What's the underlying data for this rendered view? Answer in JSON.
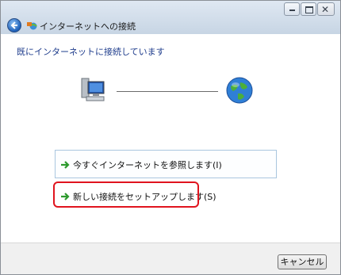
{
  "window": {
    "title": "インターネットへの接続",
    "controls": [
      "minimize",
      "maximize",
      "close"
    ]
  },
  "header": {
    "back_icon": "back-arrow-icon",
    "app_icon": "network-connect-icon"
  },
  "main": {
    "status_text": "既にインターネットに接続しています",
    "diagram": {
      "left_icon": "computer-icon",
      "right_icon": "globe-icon"
    },
    "options": [
      {
        "label": "今すぐインターネットを参照します(I)",
        "icon": "green-arrow-icon"
      },
      {
        "label": "新しい接続をセットアップします(S)",
        "icon": "green-arrow-icon",
        "annotated": true
      }
    ]
  },
  "footer": {
    "cancel_label": "キャンセル"
  },
  "colors": {
    "heading": "#1e3c8c",
    "annotation_border": "#e0141e",
    "option_border": "#a9c6df"
  }
}
